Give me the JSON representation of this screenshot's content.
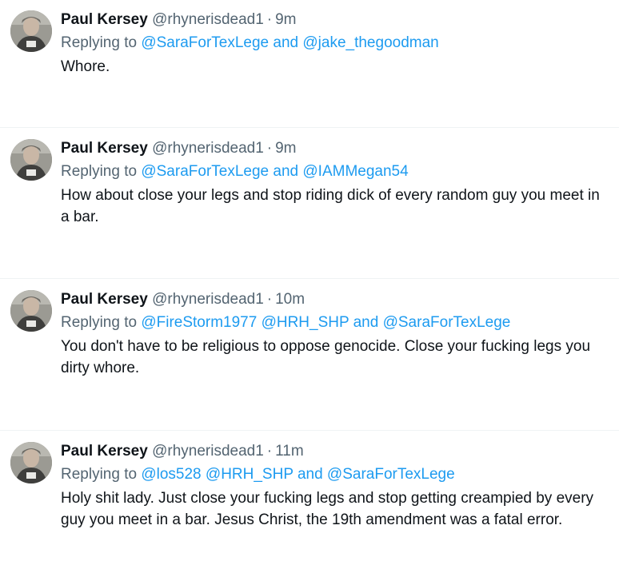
{
  "tweets": [
    {
      "name": "Paul Kersey",
      "handle": "@rhynerisdead1",
      "separator": "·",
      "time": "9m",
      "replying_prefix": "Replying to",
      "mentions": [
        "@SaraForTexLege",
        "@jake_thegoodman"
      ],
      "joiners": [
        "and"
      ],
      "text": "Whore."
    },
    {
      "name": "Paul Kersey",
      "handle": "@rhynerisdead1",
      "separator": "·",
      "time": "9m",
      "replying_prefix": "Replying to",
      "mentions": [
        "@SaraForTexLege",
        "@IAMMegan54"
      ],
      "joiners": [
        "and"
      ],
      "text": "How about close your legs and stop riding dick of every random guy you meet in a bar."
    },
    {
      "name": "Paul Kersey",
      "handle": "@rhynerisdead1",
      "separator": "·",
      "time": "10m",
      "replying_prefix": "Replying to",
      "mentions": [
        "@FireStorm1977",
        "@HRH_SHP",
        "@SaraForTexLege"
      ],
      "joiners": [
        "",
        "and"
      ],
      "text": "You don't have to be religious to oppose genocide. Close your fucking legs you dirty whore."
    },
    {
      "name": "Paul Kersey",
      "handle": "@rhynerisdead1",
      "separator": "·",
      "time": "11m",
      "replying_prefix": "Replying to",
      "mentions": [
        "@los528",
        "@HRH_SHP",
        "@SaraForTexLege"
      ],
      "joiners": [
        "",
        "and"
      ],
      "text": "Holy shit lady. Just close your fucking legs and stop getting creampied by every guy you meet in a bar. Jesus Christ, the 19th amendment was a fatal error."
    }
  ]
}
